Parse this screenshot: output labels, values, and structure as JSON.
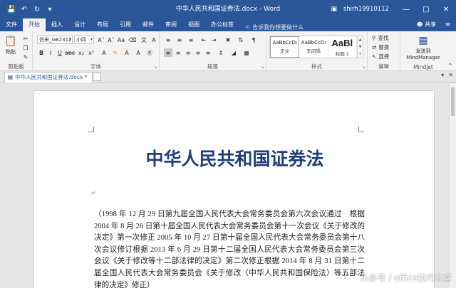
{
  "titlebar": {
    "document_title": "中华人民共和国证券法.docx - Word",
    "account": "shirh19910112"
  },
  "tabs": [
    {
      "label": "文件"
    },
    {
      "label": "开始"
    },
    {
      "label": "插入"
    },
    {
      "label": "设计"
    },
    {
      "label": "布局"
    },
    {
      "label": "引用"
    },
    {
      "label": "邮件"
    },
    {
      "label": "审阅"
    },
    {
      "label": "视图"
    },
    {
      "label": "办公标签"
    }
  ],
  "active_tab": "开始",
  "tell_me": "告诉我你想要做什么",
  "share_label": "共享",
  "ribbon": {
    "clipboard": {
      "paste_label": "粘贴",
      "group_label": "剪贴板"
    },
    "font": {
      "font_name": "仿宋_GB2312",
      "font_size": "小四",
      "group_label": "字体"
    },
    "paragraph": {
      "group_label": "段落"
    },
    "styles": {
      "items": [
        {
          "sample": "AaBbCcDı",
          "name": "正文"
        },
        {
          "sample": "AaBbCcDı",
          "name": "无间隔"
        },
        {
          "sample": "AaBl",
          "name": "标题 1"
        }
      ],
      "group_label": "样式"
    },
    "editing": {
      "find": "查找",
      "replace": "替换",
      "select": "选择",
      "group_label": "编辑"
    },
    "mindjet": {
      "button_line1": "发送到",
      "button_line2": "MindManager",
      "group_label": "Mindjet"
    }
  },
  "document_tab": {
    "label": "中华人民共和国证券法.docx *"
  },
  "document": {
    "heading": "中华人民共和国证券法",
    "body": "（1998 年 12 月 29 日第九届全国人民代表大会常务委员会第六次会议通过　根据 2004 年 8 月 28 日第十届全国人民代表大会常务委员会第十一次会议《关于修改的决定》第一次修正 2005 年 10 月 27 日第十届全国人民代表大会常务委员会第十八次会议修订根据 2013 年 6 月 29 日第十二届全国人民代表大会常务委员会第三次会议《关于修改等十二部法律的决定》第二次修正根据 2014 年 8 月 31 日第十二届全国人民代表大会常务委员会《关于修改〈中华人民共和国保险法〉等五部法律的决定》修正）"
  },
  "watermark": "头条号 / office技巧分享",
  "colors": {
    "ribbon_blue": "#2b579a",
    "heading_blue": "#1f3f79"
  }
}
